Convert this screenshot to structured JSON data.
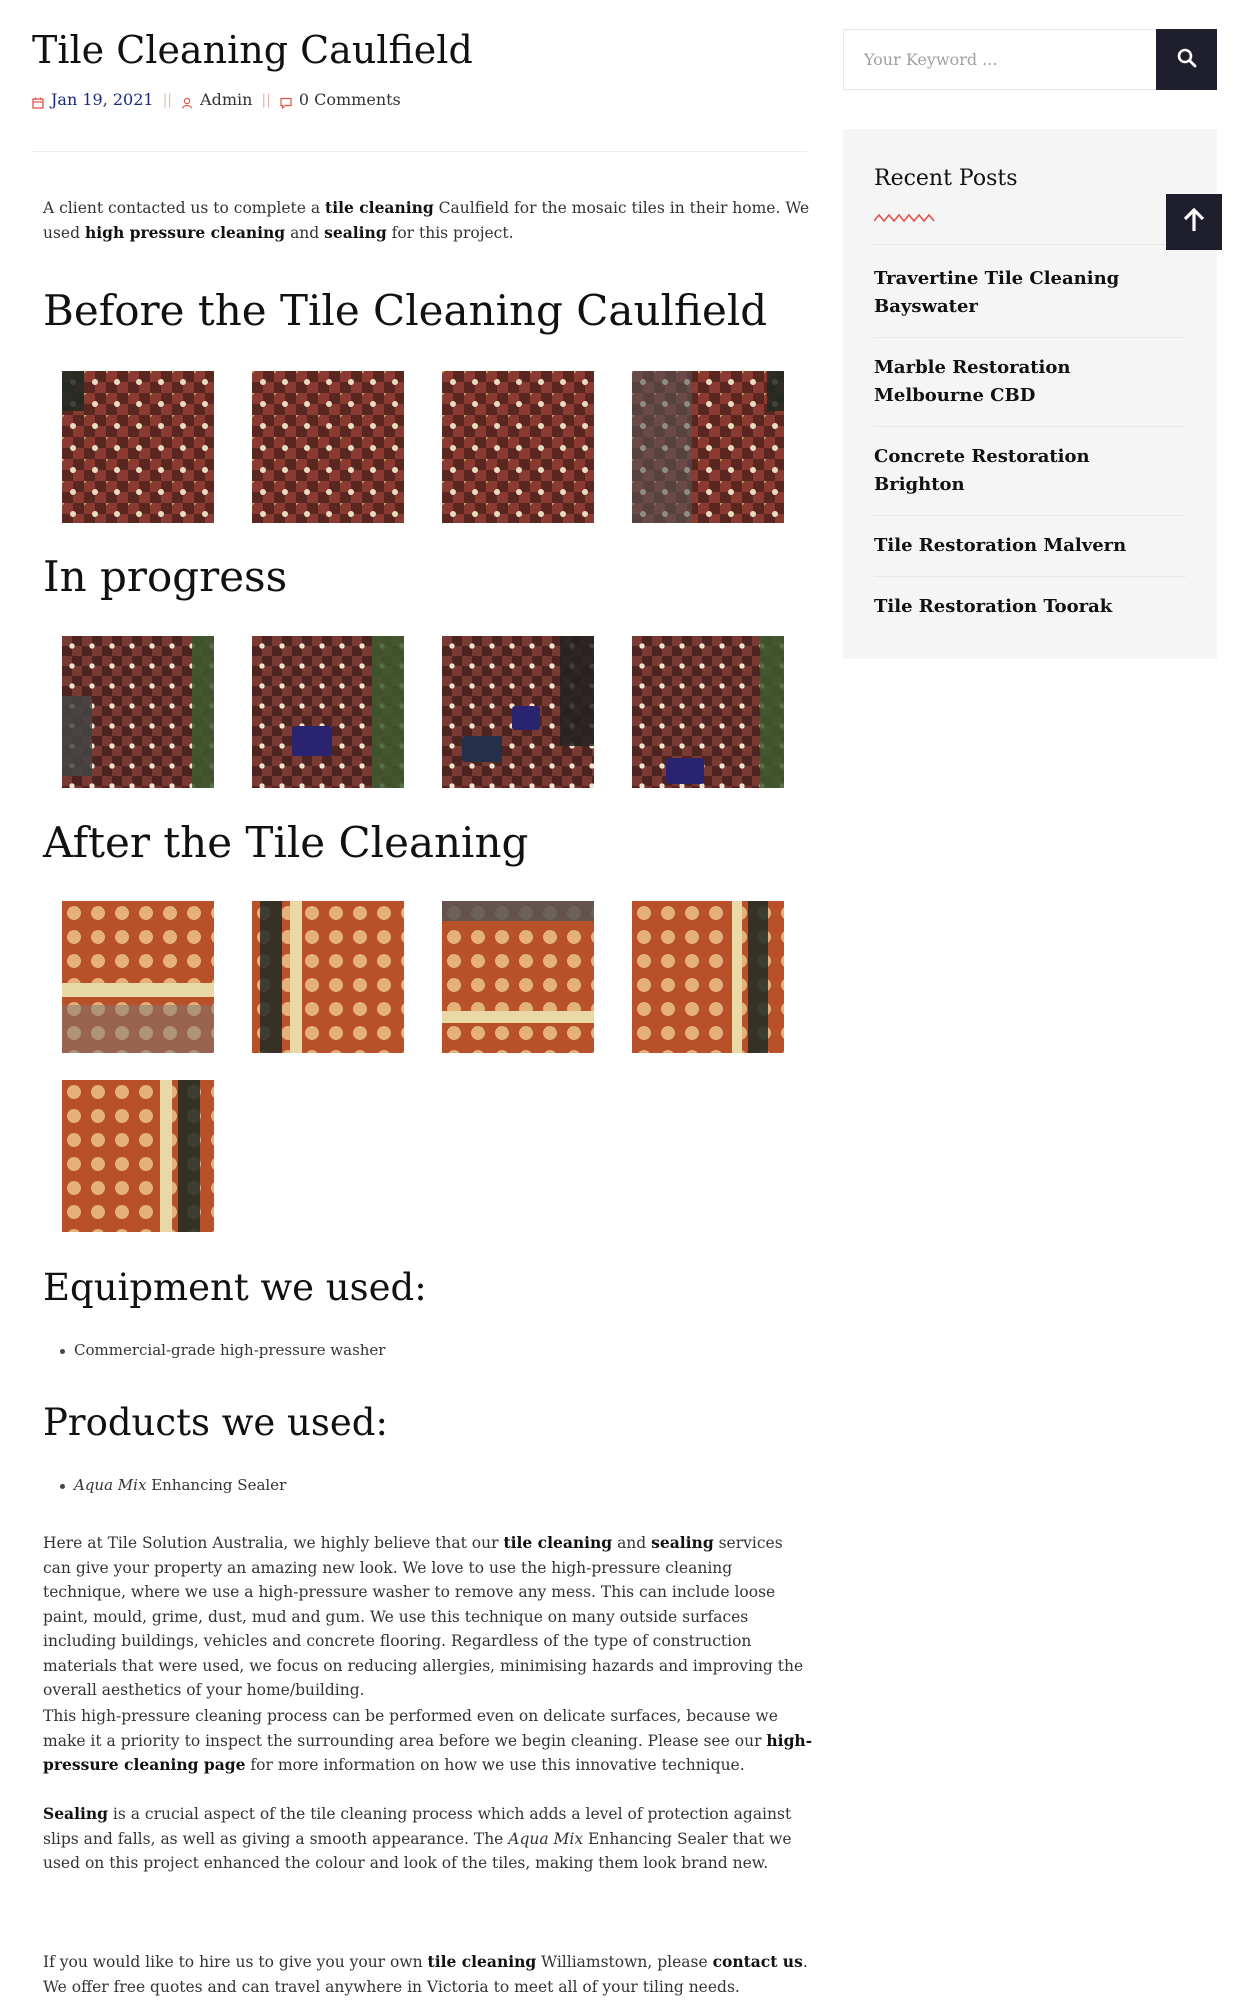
{
  "post": {
    "title": "Tile Cleaning Caulfield",
    "date": "Jan 19, 2021",
    "author": "Admin",
    "comments": "0 Comments",
    "meta_separator": "||"
  },
  "intro": {
    "t1": "A client contacted us to complete a ",
    "b1": "tile cleaning",
    "t2": " Caulfield for the mosaic tiles in their home. We used ",
    "b2": "high pressure cleaning",
    "t3": " and ",
    "b3": "sealing",
    "t4": " for this project."
  },
  "sections": {
    "before": "Before the Tile Cleaning Caulfield",
    "progress": "In progress",
    "after": "After the Tile Cleaning",
    "equipment": "Equipment we used:",
    "products": "Products we used:"
  },
  "equipment_items": [
    "Commercial-grade high-pressure washer"
  ],
  "product_item": {
    "brand": "Aqua Mix",
    "name": " Enhancing Sealer"
  },
  "body1": {
    "t1": "Here at Tile Solution Australia, we highly believe that our ",
    "b1": "tile cleaning",
    "t2": " and ",
    "b2": "sealing",
    "t3": " services can give your property an amazing new look. We love to use the high-pressure cleaning technique, where we use a high-pressure washer to remove any mess. This can include loose paint, mould, grime, dust, mud and gum. We use this technique on many outside surfaces including buildings, vehicles and concrete flooring. Regardless of the type of construction materials that were used, we focus on reducing allergies, minimising hazards and improving the overall aesthetics of your home/building."
  },
  "body2": {
    "t1": "This high-pressure cleaning process can be performed even on delicate surfaces, because we make it a priority to inspect the surrounding area before we begin cleaning. Please see our ",
    "b1": "high-pressure cleaning page",
    "t2": " for more information on how we use this innovative technique."
  },
  "body3": {
    "b1": "Sealing",
    "t1": " is a crucial aspect of the tile cleaning process which adds a level of protection against slips and falls, as well as giving a smooth appearance. The ",
    "i1": "Aqua Mix",
    "t2": " Enhancing Sealer that we used on this project enhanced the colour and look of the tiles, making them look brand new."
  },
  "body4": {
    "t1": "If you would like to hire us to give you your own ",
    "b1": "tile cleaning",
    "t2": " Williamstown, please ",
    "b2": "contact us",
    "t3": ". We offer free quotes and can travel anywhere in Victoria to meet all of your tiling needs."
  },
  "search": {
    "placeholder": "Your Keyword ..."
  },
  "sidebar": {
    "recent_title": "Recent Posts",
    "posts": [
      "Travertine Tile Cleaning Bayswater",
      "Marble Restoration Melbourne CBD",
      "Concrete Restoration Brighton",
      "Tile Restoration Malvern",
      "Tile Restoration Toorak"
    ]
  },
  "colors": {
    "accent": "#e2554a",
    "dark": "#1e1e2c",
    "date_link": "#1b2a7a"
  },
  "icons": [
    "calendar-icon",
    "user-icon",
    "comment-icon",
    "search-icon",
    "arrow-up-icon"
  ]
}
